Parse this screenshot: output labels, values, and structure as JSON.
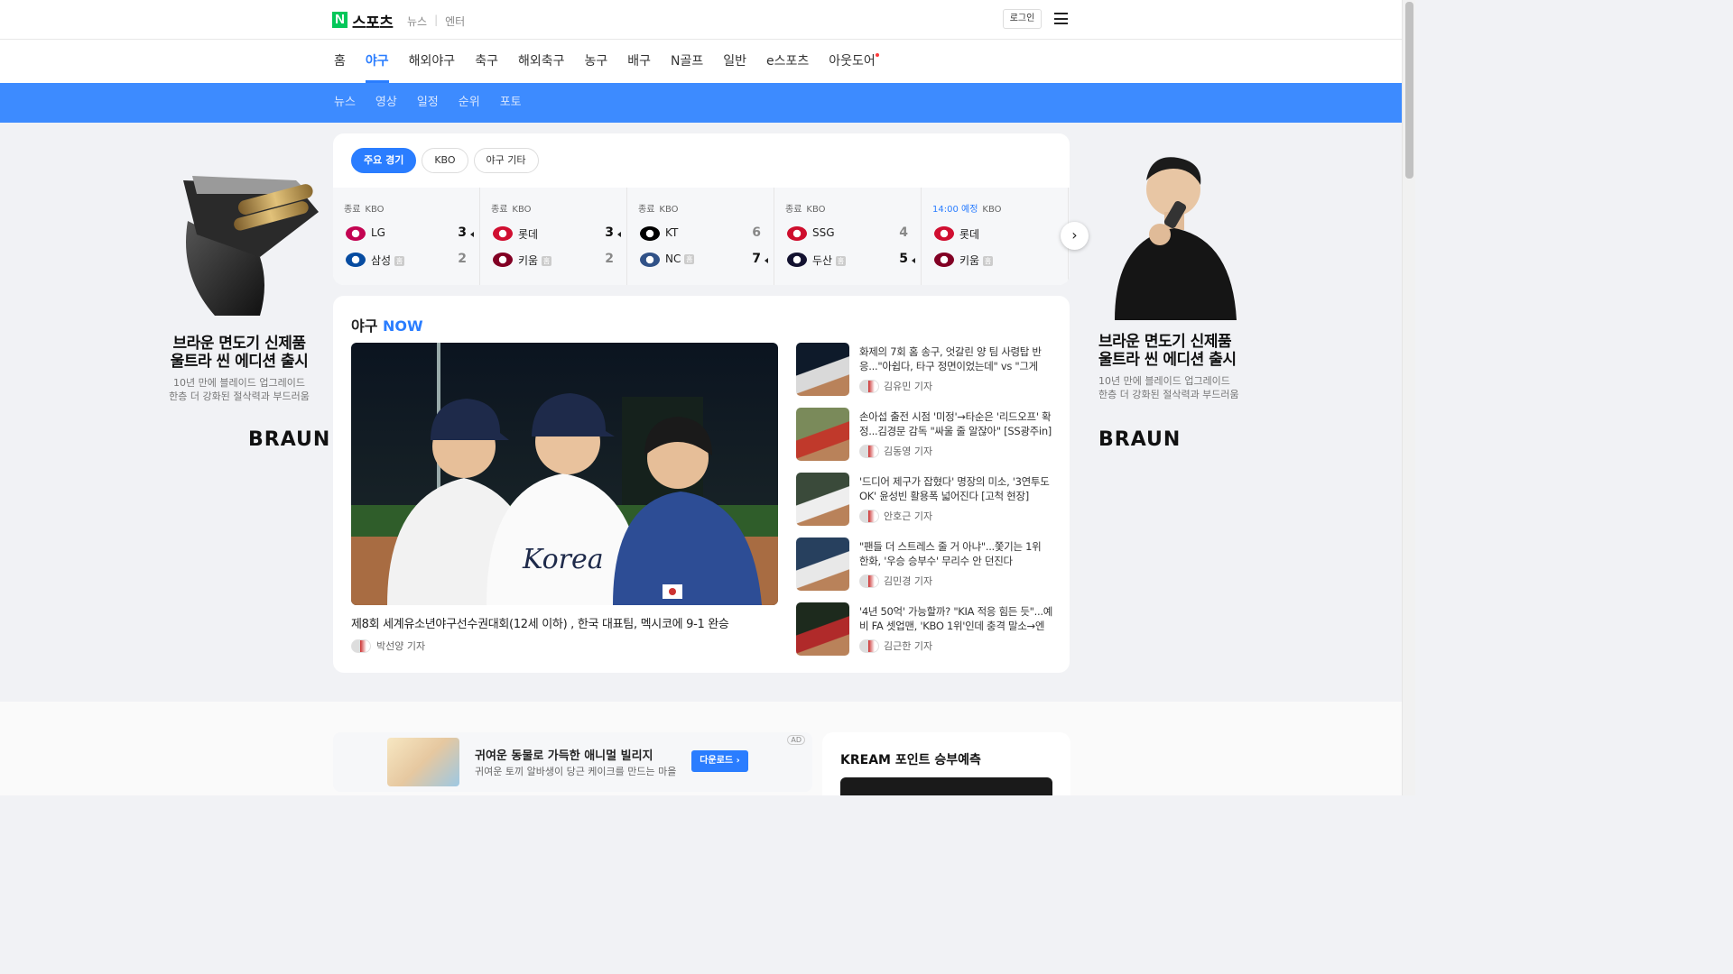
{
  "header": {
    "logo_text": "스포츠",
    "top_links": [
      "뉴스",
      "엔터"
    ],
    "login_label": "로그인"
  },
  "gnb": {
    "items": [
      "홈",
      "야구",
      "해외야구",
      "축구",
      "해외축구",
      "농구",
      "배구",
      "N골프",
      "일반",
      "e스포츠",
      "아웃도어"
    ],
    "active": "야구"
  },
  "subnav": {
    "items": [
      "뉴스",
      "영상",
      "일정",
      "순위",
      "포토"
    ]
  },
  "game_tabs": {
    "items": [
      "주요 경기",
      "KBO",
      "야구 기타"
    ],
    "active": "주요 경기"
  },
  "games": [
    {
      "status": "종료",
      "league": "KBO",
      "teams": [
        {
          "name": "LG",
          "score": "3",
          "win": true,
          "color": "#c30452"
        },
        {
          "name": "삼성",
          "score": "2",
          "sp": "홈",
          "color": "#074ca1"
        }
      ]
    },
    {
      "status": "종료",
      "league": "KBO",
      "teams": [
        {
          "name": "롯데",
          "score": "3",
          "win": true,
          "color": "#d00f31"
        },
        {
          "name": "키움",
          "score": "2",
          "sp": "홈",
          "color": "#820024"
        }
      ]
    },
    {
      "status": "종료",
      "league": "KBO",
      "teams": [
        {
          "name": "KT",
          "score": "6",
          "color": "#000000"
        },
        {
          "name": "NC",
          "score": "7",
          "win": true,
          "sp": "홈",
          "color": "#315288"
        }
      ]
    },
    {
      "status": "종료",
      "league": "KBO",
      "teams": [
        {
          "name": "SSG",
          "score": "4",
          "color": "#ce0e2d"
        },
        {
          "name": "두산",
          "score": "5",
          "win": true,
          "sp": "홈",
          "color": "#131230"
        }
      ]
    },
    {
      "status": "14:00 예정",
      "league": "KBO",
      "scheduled": true,
      "teams": [
        {
          "name": "롯데",
          "score": "",
          "color": "#d00f31"
        },
        {
          "name": "키움",
          "score": "",
          "sp": "홈",
          "color": "#820024"
        }
      ]
    }
  ],
  "now": {
    "title_prefix": "야구",
    "title_suffix": "NOW",
    "main_headline": "제8회 세계유소년야구선수권대회(12세 이하) , 한국 대표팀, 멕시코에 9-1 완승",
    "main_author": "박선양 기자",
    "news": [
      {
        "title": "화제의 7회 홈 송구, 엇갈린 양 팀 사령탑 반응...\"아쉽다, 타구 정면이었는데\" vs \"그게 우...",
        "author": "김유민 기자"
      },
      {
        "title": "손아섭 출전 시점 '미정'→타순은 '리드오프' 확정...김경문 감독 \"싸울 줄 알잖아\" [SS광주in]",
        "author": "김동영 기자"
      },
      {
        "title": "'드디어 제구가 잡혔다' 명장의 미소, '3연투도 OK' 윤성빈 활용폭 넓어진다 [고척 현장]",
        "author": "안호근 기자"
      },
      {
        "title": "\"팬들 더 스트레스 줄 거 아냐\"...쫓기는 1위 한화, '우승 승부수' 무리수 안 던진다",
        "author": "김민경 기자"
      },
      {
        "title": "'4년 50억' 가능할까? \"KIA 적응 힘든 듯\"...예비 FA 셋업맨, 'KBO 1위'인데 충격 말소→엔탈 ...",
        "author": "김근한 기자"
      }
    ]
  },
  "side_ad": {
    "line1": "브라운 면도기 신제품",
    "line2": "울트라 씬 에디션 출시",
    "sub1": "10년 만에 블레이드 업그레이드",
    "sub2": "한층 더 강화된 절삭력과 부드러움",
    "brand": "BRAUN"
  },
  "app_ad": {
    "title": "귀여운 동물로 가득한 애니멀 빌리지",
    "desc": "귀여운 토끼 알바생이 당근 케이크를 만드는 마을",
    "button": "다운로드 ›",
    "badge": "AD"
  },
  "kream": {
    "title": "KREAM 포인트 승부예측"
  }
}
